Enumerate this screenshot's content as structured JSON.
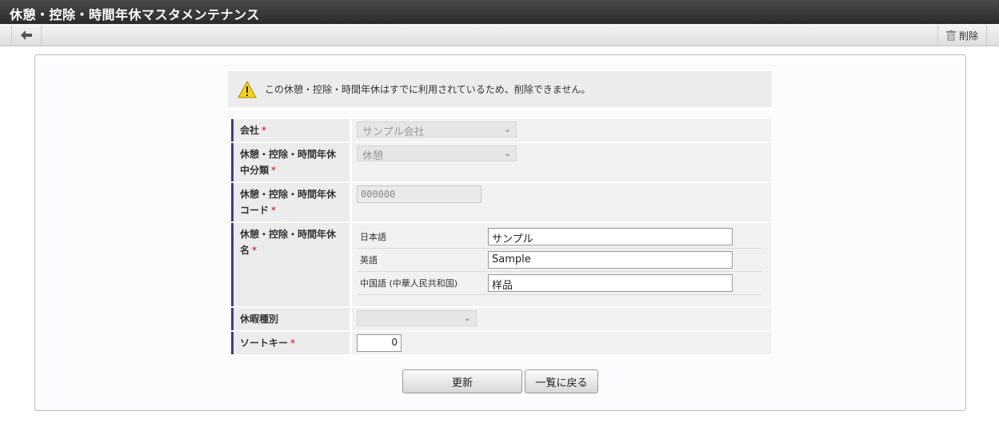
{
  "window": {
    "title": "休憩・控除・時間年休マスタメンテナンス"
  },
  "toolbar": {
    "delete_label": "削除"
  },
  "warning": {
    "message": "この休憩・控除・時間年休はすでに利用されているため、削除できません。"
  },
  "form": {
    "company": {
      "label": "会社",
      "required": "*",
      "value": "サンプル会社"
    },
    "category": {
      "label": "休憩・控除・時間年休中分類",
      "required": "*",
      "value": "休憩"
    },
    "code": {
      "label": "休憩・控除・時間年休コード",
      "required": "*",
      "value": "000000"
    },
    "name": {
      "label": "休憩・控除・時間年休名",
      "required": "*",
      "rows": [
        {
          "lang": "日本語",
          "value": "サンプル"
        },
        {
          "lang": "英語",
          "value": "Sample"
        },
        {
          "lang": "中国語 (中華人民共和国)",
          "value": "样品"
        }
      ]
    },
    "leave_type": {
      "label": "休暇種別",
      "value": ""
    },
    "sort_key": {
      "label": "ソートキー",
      "required": "*",
      "value": "0"
    }
  },
  "buttons": {
    "update": "更新",
    "back_to_list": "一覧に戻る"
  },
  "colors": {
    "accent_bar": "#34418e",
    "title_bg": "#333333",
    "required_mark": "#dd0000"
  }
}
